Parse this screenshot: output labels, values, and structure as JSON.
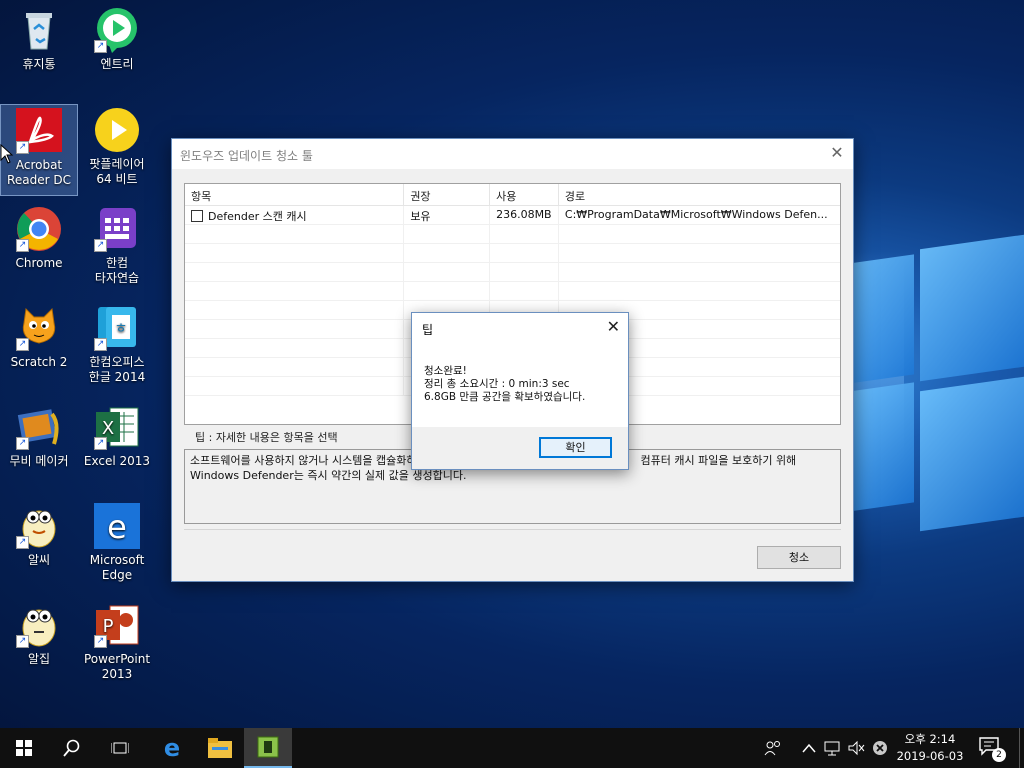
{
  "desktop": {
    "icons": [
      {
        "label": "휴지통"
      },
      {
        "label": "엔트리"
      },
      {
        "label": "Acrobat\nReader DC"
      },
      {
        "label": "팟플레이어\n64 비트"
      },
      {
        "label": "Chrome"
      },
      {
        "label": "한컴\n타자연습"
      },
      {
        "label": "Scratch 2"
      },
      {
        "label": "한컴오피스\n한글 2014"
      },
      {
        "label": "무비 메이커"
      },
      {
        "label": "Excel 2013"
      },
      {
        "label": "알씨"
      },
      {
        "label": "Microsoft\nEdge"
      },
      {
        "label": "알집"
      },
      {
        "label": "PowerPoint\n2013"
      }
    ]
  },
  "window": {
    "title": "윈도우즈 업데이트 청소 툴",
    "columns": [
      "항목",
      "권장",
      "사용",
      "경로"
    ],
    "rows": [
      {
        "item": "Defender 스캔 캐시",
        "recommend": "보유",
        "usage": "236.08MB",
        "path": "C:₩ProgramData₩Microsoft₩Windows Defen..."
      }
    ],
    "tip_legend": "팁 : 자세한 내용은 항목을 선택",
    "tip_text_line1": "소프트웨어를 사용하지 않거나 시스템을 캡슐화하",
    "tip_text_line1_end": "컴퓨터 캐시 파일을 보호하기 위해",
    "tip_text_line2": "Windows Defender는 즉시 약간의 실제 값을 생성합니다.",
    "clean_button": "청소"
  },
  "dialog": {
    "title": "팁",
    "line1": "청소완료!",
    "line2": "정리 총 소요시간 : 0 min:3 sec",
    "line3": "6.8GB 만큼 공간을 확보하였습니다.",
    "ok_button": "확인"
  },
  "taskbar": {
    "time": "오후 2:14",
    "date": "2019-06-03",
    "notification_count": "2"
  }
}
